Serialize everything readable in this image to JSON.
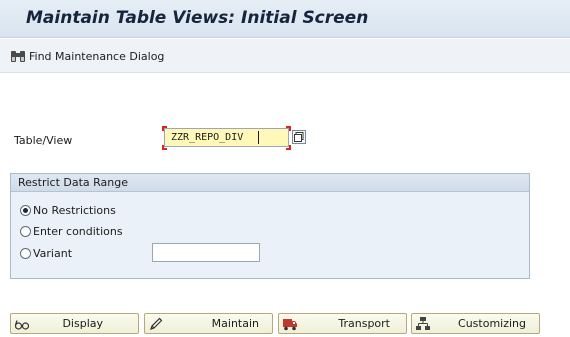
{
  "title": "Maintain Table Views: Initial Screen",
  "toolbar": {
    "find_label": "Find Maintenance Dialog",
    "find_icon": "binoculars-icon"
  },
  "form": {
    "table_label": "Table/View",
    "table_value": "ZZR_REPO_DIV"
  },
  "restrict": {
    "header": "Restrict Data Range",
    "options": [
      {
        "label": "No Restrictions",
        "selected": true
      },
      {
        "label": "Enter conditions",
        "selected": false
      },
      {
        "label": "Variant",
        "selected": false
      }
    ],
    "variant_value": ""
  },
  "buttons": {
    "display": "Display",
    "maintain": "Maintain",
    "transport": "Transport",
    "customizing": "Customizing"
  },
  "colors": {
    "title_bg": "#dce6f0",
    "required_marker": "#d9261c",
    "input_highlight": "#fff8b8",
    "button_bg": "#f4f3e0"
  }
}
